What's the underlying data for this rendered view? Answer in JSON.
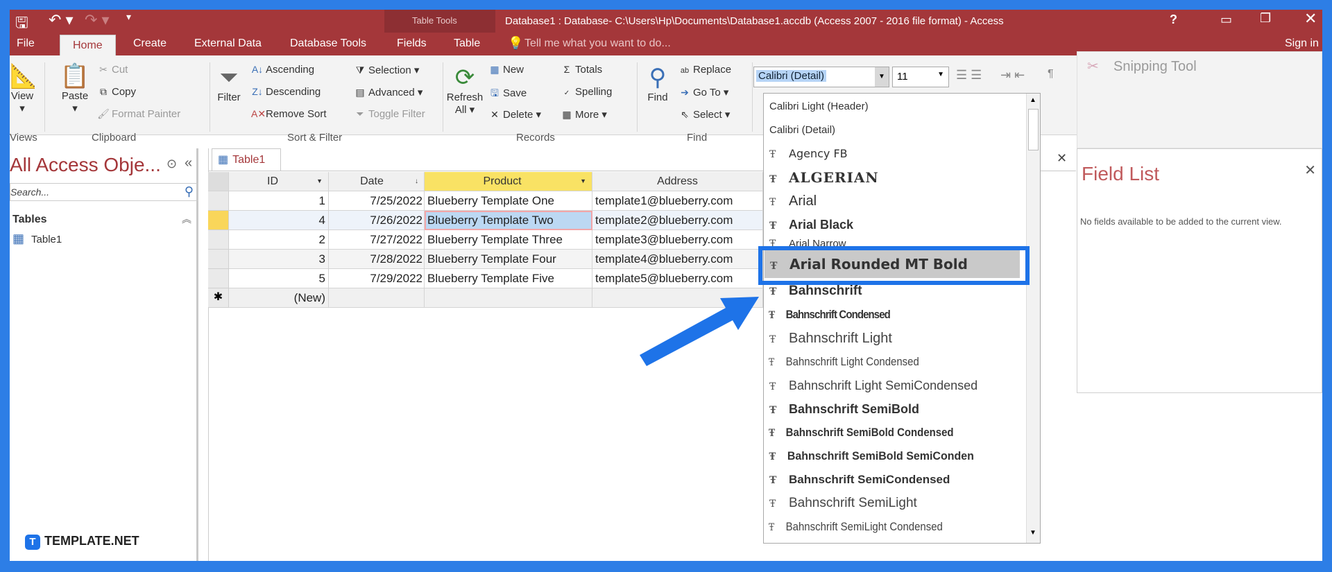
{
  "title": "Database1 : Database- C:\\Users\\Hp\\Documents\\Database1.accdb (Access 2007 - 2016 file format) - Access",
  "context_tab": "Table Tools",
  "tabs": [
    "File",
    "Home",
    "Create",
    "External Data",
    "Database Tools",
    "Fields",
    "Table"
  ],
  "tell_me": "Tell me what you want to do...",
  "sign_in": "Sign in",
  "ribbon": {
    "view": "View",
    "views": "Views",
    "paste": "Paste",
    "cut": "Cut",
    "copy": "Copy",
    "format_painter": "Format Painter",
    "clipboard": "Clipboard",
    "filter": "Filter",
    "ascending": "Ascending",
    "descending": "Descending",
    "remove_sort": "Remove Sort",
    "selection": "Selection",
    "advanced": "Advanced",
    "toggle_filter": "Toggle Filter",
    "sort_filter": "Sort & Filter",
    "refresh": "Refresh",
    "all": "All",
    "new": "New",
    "save": "Save",
    "delete": "Delete",
    "totals": "Totals",
    "spelling": "Spelling",
    "more": "More",
    "records": "Records",
    "find": "Find",
    "replace": "Replace",
    "go_to": "Go To",
    "select": "Select",
    "find_group": "Find",
    "font_value": "Calibri (Detail)",
    "size_value": "11"
  },
  "nav": {
    "title": "All Access Obje...",
    "search_placeholder": "Search...",
    "section": "Tables",
    "item": "Table1"
  },
  "doc_tab": "Table1",
  "table": {
    "columns": [
      "ID",
      "Date",
      "Product",
      "Address"
    ],
    "rows": [
      [
        "1",
        "7/25/2022",
        "Blueberry Template One",
        "template1@blueberry.com"
      ],
      [
        "4",
        "7/26/2022",
        "Blueberry Template Two",
        "template2@blueberry.com"
      ],
      [
        "2",
        "7/27/2022",
        "Blueberry Template Three",
        "template3@blueberry.com"
      ],
      [
        "3",
        "7/28/2022",
        "Blueberry Template Four",
        "template4@blueberry.com"
      ],
      [
        "5",
        "7/29/2022",
        "Blueberry Template Five",
        "template5@blueberry.com"
      ]
    ],
    "new_row": "(New)"
  },
  "fonts": {
    "theme": [
      "Calibri Light (Header)",
      "Calibri (Detail)"
    ],
    "list": [
      "Agency FB",
      "ALGERIAN",
      "Arial",
      "Arial Black",
      "Arial Narrow",
      "Arial Rounded MT Bold",
      "Bahnschrift",
      "Bahnschrift Condensed",
      "Bahnschrift Light",
      "Bahnschrift Light Condensed",
      "Bahnschrift Light SemiCondensed",
      "Bahnschrift SemiBold",
      "Bahnschrift SemiBold Condensed",
      "Bahnschrift SemiBold SemiConden",
      "Bahnschrift SemiCondensed",
      "Bahnschrift SemiLight",
      "Bahnschrift SemiLight Condensed"
    ],
    "highlighted": "Arial Rounded MT Bold"
  },
  "field_list": {
    "title": "Field List",
    "message": "No fields available to be added to the current view."
  },
  "snipping": "Snipping Tool",
  "brand": "TEMPLATE.NET",
  "colors": {
    "accent": "#a4373a",
    "frame": "#2d7ee6",
    "highlight": "#1e73e8"
  }
}
